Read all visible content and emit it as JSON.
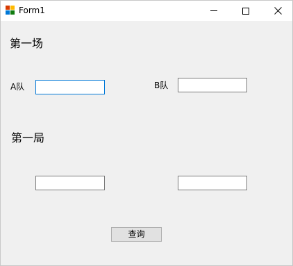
{
  "window": {
    "title": "Form1",
    "icon": "winforms-app-icon",
    "controls": {
      "minimize_icon": "minimize-icon",
      "maximize_icon": "maximize-icon",
      "close_glyph": "✕"
    }
  },
  "form": {
    "match_label": "第一场",
    "team_a_label": "A队",
    "team_b_label": "B队",
    "team_a_value": "",
    "team_b_value": "",
    "game_label": "第一局",
    "score_a_value": "",
    "score_b_value": "",
    "query_button_label": "查询"
  },
  "colors": {
    "client_background": "#f0f0f0",
    "titlebar_background": "#ffffff",
    "focused_border": "#0078d7",
    "textbox_border": "#7a7a7a",
    "button_background": "#e1e1e1"
  }
}
